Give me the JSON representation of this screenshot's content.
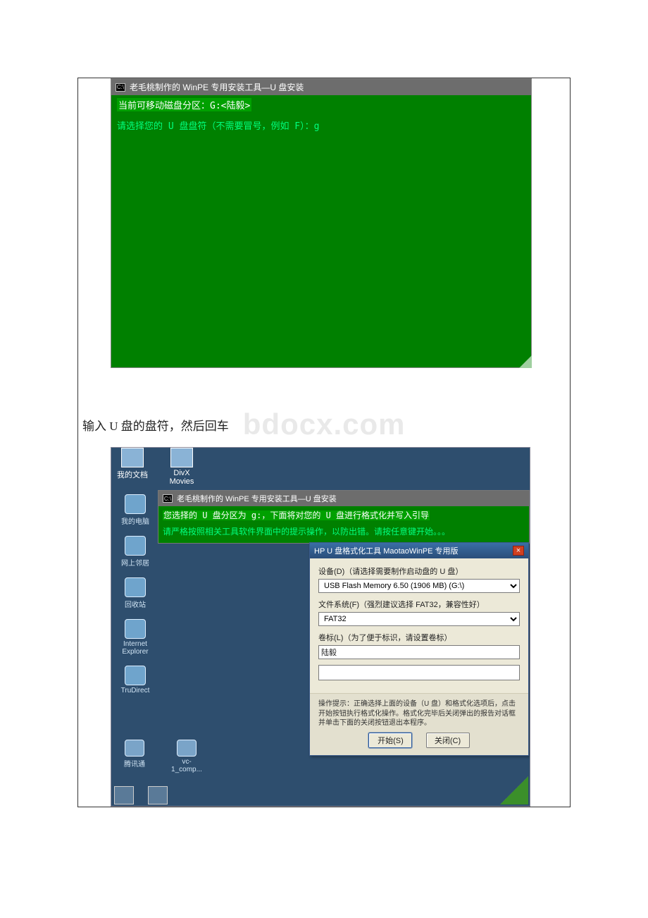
{
  "console1": {
    "title": "老毛桃制作的 WinPE 专用安装工具—U 盘安装",
    "cmd_icon_label": "C:\\",
    "line1": "当前可移动磁盘分区：G:<陆毅>",
    "line2": "请选择您的 U 盘盘符（不需要冒号，例如 F）：g"
  },
  "caption": "输入 U 盘的盘符，然后回车",
  "watermark": "bdocx.com",
  "desktop": {
    "top_icons": [
      {
        "label": "我的文档"
      },
      {
        "label": "DivX Movies"
      }
    ],
    "left_icons": [
      {
        "label": "我的电脑"
      },
      {
        "label": "网上邻居"
      },
      {
        "label": "回收站"
      },
      {
        "label": "Internet Explorer"
      },
      {
        "label": "TruDirect"
      }
    ],
    "bottom_icons": [
      {
        "label": "腾讯通"
      },
      {
        "label": "vc-1_comp..."
      }
    ]
  },
  "console2": {
    "title": "老毛桃制作的 WinPE 专用安装工具—U 盘安装",
    "line1": "您选择的 U 盘分区为 g:，下面将对您的 U 盘进行格式化并写入引导",
    "line2": "请严格按照相关工具软件界面中的提示操作，以防出错。请按任意键开始。。。"
  },
  "dialog": {
    "title": "HP U 盘格式化工具 MaotaoWinPE 专用版",
    "device_label": "设备(D)（请选择需要制作启动盘的 U 盘）",
    "device_value": "USB Flash Memory 6.50 (1906 MB) (G:\\)",
    "filesys_label": "文件系统(F)（强烈建议选择 FAT32，兼容性好）",
    "filesys_value": "FAT32",
    "volume_label": "卷标(L)（为了便于标识，请设置卷标）",
    "volume_value": "陆毅",
    "options_label": "",
    "hint": "操作提示：正确选择上面的设备（U 盘）和格式化选项后，点击开始按钮执行格式化操作。格式化完毕后关闭弹出的报告对话框并单击下面的关闭按钮退出本程序。",
    "btn_start": "开始(S)",
    "btn_close": "关闭(C)"
  }
}
